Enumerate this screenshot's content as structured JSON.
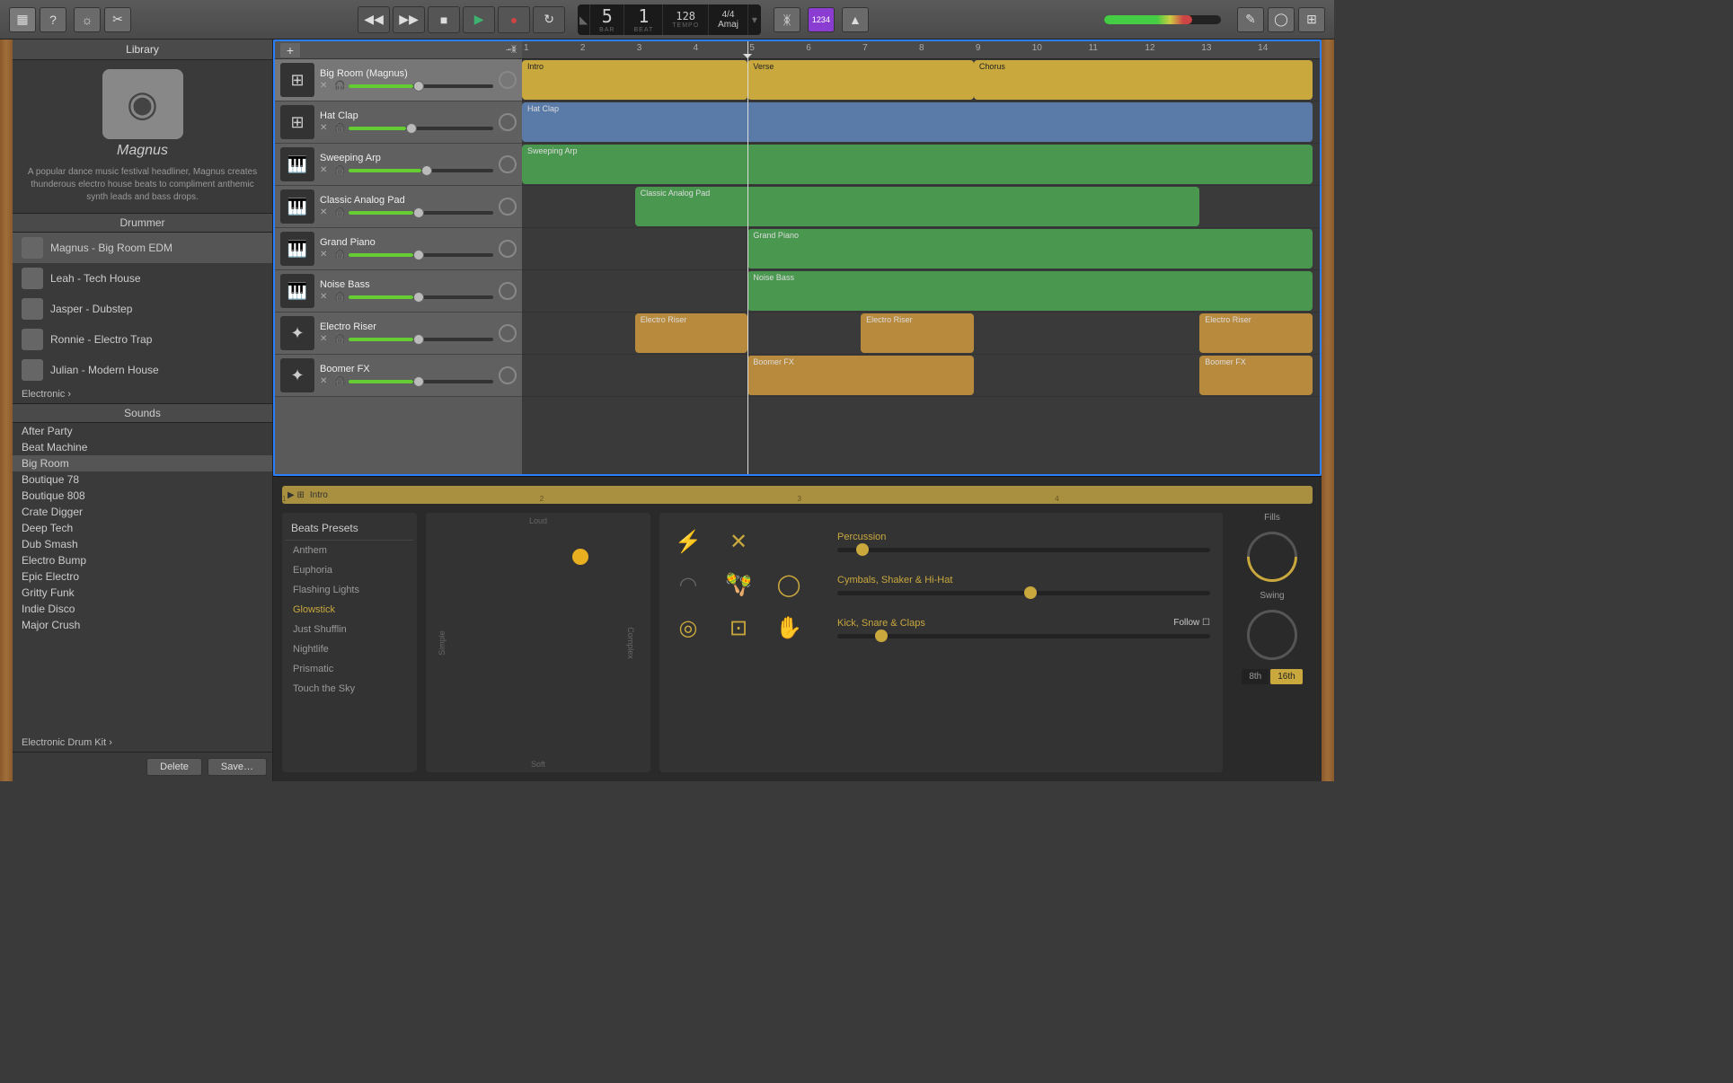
{
  "toolbar": {
    "display": {
      "bar": "5",
      "beat": "1",
      "bar_label": "BAR",
      "beat_label": "BEAT",
      "tempo": "128",
      "tempo_label": "TEMPO",
      "sig": "4/4",
      "key": "Amaj"
    },
    "countin": "1234"
  },
  "library": {
    "title": "Library",
    "signature": "Magnus",
    "description": "A popular dance music festival headliner, Magnus creates thunderous electro house beats to compliment anthemic synth leads and bass drops.",
    "drummer_header": "Drummer",
    "drummers": [
      {
        "name": "Magnus - Big Room EDM",
        "selected": true
      },
      {
        "name": "Leah - Tech House"
      },
      {
        "name": "Jasper - Dubstep"
      },
      {
        "name": "Ronnie - Electro Trap"
      },
      {
        "name": "Julian - Modern House"
      }
    ],
    "breadcrumb1": "Electronic  ›",
    "sounds_header": "Sounds",
    "sounds": [
      "After Party",
      "Beat Machine",
      "Big Room",
      "Boutique 78",
      "Boutique 808",
      "Crate Digger",
      "Deep Tech",
      "Dub Smash",
      "Electro Bump",
      "Epic Electro",
      "Gritty Funk",
      "Indie Disco",
      "Major Crush"
    ],
    "sounds_selected": "Big Room",
    "breadcrumb2": "Electronic Drum Kit  ›",
    "delete_btn": "Delete",
    "save_btn": "Save…"
  },
  "tracks": {
    "ruler_markers": [
      "1",
      "2",
      "3",
      "4",
      "5",
      "6",
      "7",
      "8",
      "9",
      "10",
      "11",
      "12",
      "13",
      "14"
    ],
    "playhead_bar": 5,
    "list": [
      {
        "name": "Big Room (Magnus)",
        "selected": true,
        "color": "yellow",
        "vol": 45
      },
      {
        "name": "Hat Clap",
        "color": "blue",
        "vol": 40
      },
      {
        "name": "Sweeping Arp",
        "color": "green",
        "vol": 50
      },
      {
        "name": "Classic Analog Pad",
        "color": "green",
        "vol": 45
      },
      {
        "name": "Grand Piano",
        "color": "green",
        "vol": 45
      },
      {
        "name": "Noise Bass",
        "color": "green",
        "vol": 45
      },
      {
        "name": "Electro Riser",
        "color": "orange",
        "vol": 45
      },
      {
        "name": "Boomer FX",
        "color": "orange",
        "vol": 45
      }
    ],
    "regions": [
      {
        "track": 0,
        "name": "Intro",
        "start": 1,
        "end": 5,
        "color": "yellow"
      },
      {
        "track": 0,
        "name": "Verse",
        "start": 5,
        "end": 9,
        "color": "yellow"
      },
      {
        "track": 0,
        "name": "Chorus",
        "start": 9,
        "end": 15,
        "color": "yellow"
      },
      {
        "track": 1,
        "name": "Hat Clap",
        "start": 1,
        "end": 15,
        "color": "blue"
      },
      {
        "track": 2,
        "name": "Sweeping Arp",
        "start": 1,
        "end": 15,
        "color": "green"
      },
      {
        "track": 3,
        "name": "Classic Analog Pad",
        "start": 3,
        "end": 13,
        "color": "green"
      },
      {
        "track": 4,
        "name": "Grand Piano",
        "start": 5,
        "end": 15,
        "color": "green"
      },
      {
        "track": 5,
        "name": "Noise Bass",
        "start": 5,
        "end": 15,
        "color": "green"
      },
      {
        "track": 6,
        "name": "Electro Riser",
        "start": 3,
        "end": 5,
        "color": "orange"
      },
      {
        "track": 6,
        "name": "Electro Riser",
        "start": 7,
        "end": 9,
        "color": "orange"
      },
      {
        "track": 6,
        "name": "Electro Riser",
        "start": 13,
        "end": 15,
        "color": "orange"
      },
      {
        "track": 7,
        "name": "Boomer FX",
        "start": 5,
        "end": 9,
        "color": "orange"
      },
      {
        "track": 7,
        "name": "Boomer FX",
        "start": 13,
        "end": 15,
        "color": "orange"
      }
    ]
  },
  "editor": {
    "region_name": "Intro",
    "ruler_markers": [
      "1",
      "2",
      "3",
      "4"
    ],
    "presets_header": "Beats Presets",
    "presets": [
      "Anthem",
      "Euphoria",
      "Flashing Lights",
      "Glowstick",
      "Just Shufflin",
      "Nightlife",
      "Prismatic",
      "Touch the Sky"
    ],
    "preset_selected": "Glowstick",
    "xy": {
      "loud": "Loud",
      "soft": "Soft",
      "simple": "Simple",
      "complex": "Complex"
    },
    "drum_rows": [
      {
        "label": "Percussion",
        "value": 5
      },
      {
        "label": "Cymbals, Shaker & Hi-Hat",
        "value": 50
      },
      {
        "label": "Kick, Snare & Claps",
        "value": 10,
        "follow": "Follow"
      }
    ],
    "fills_label": "Fills",
    "swing_label": "Swing",
    "note_8": "8th",
    "note_16": "16th"
  }
}
